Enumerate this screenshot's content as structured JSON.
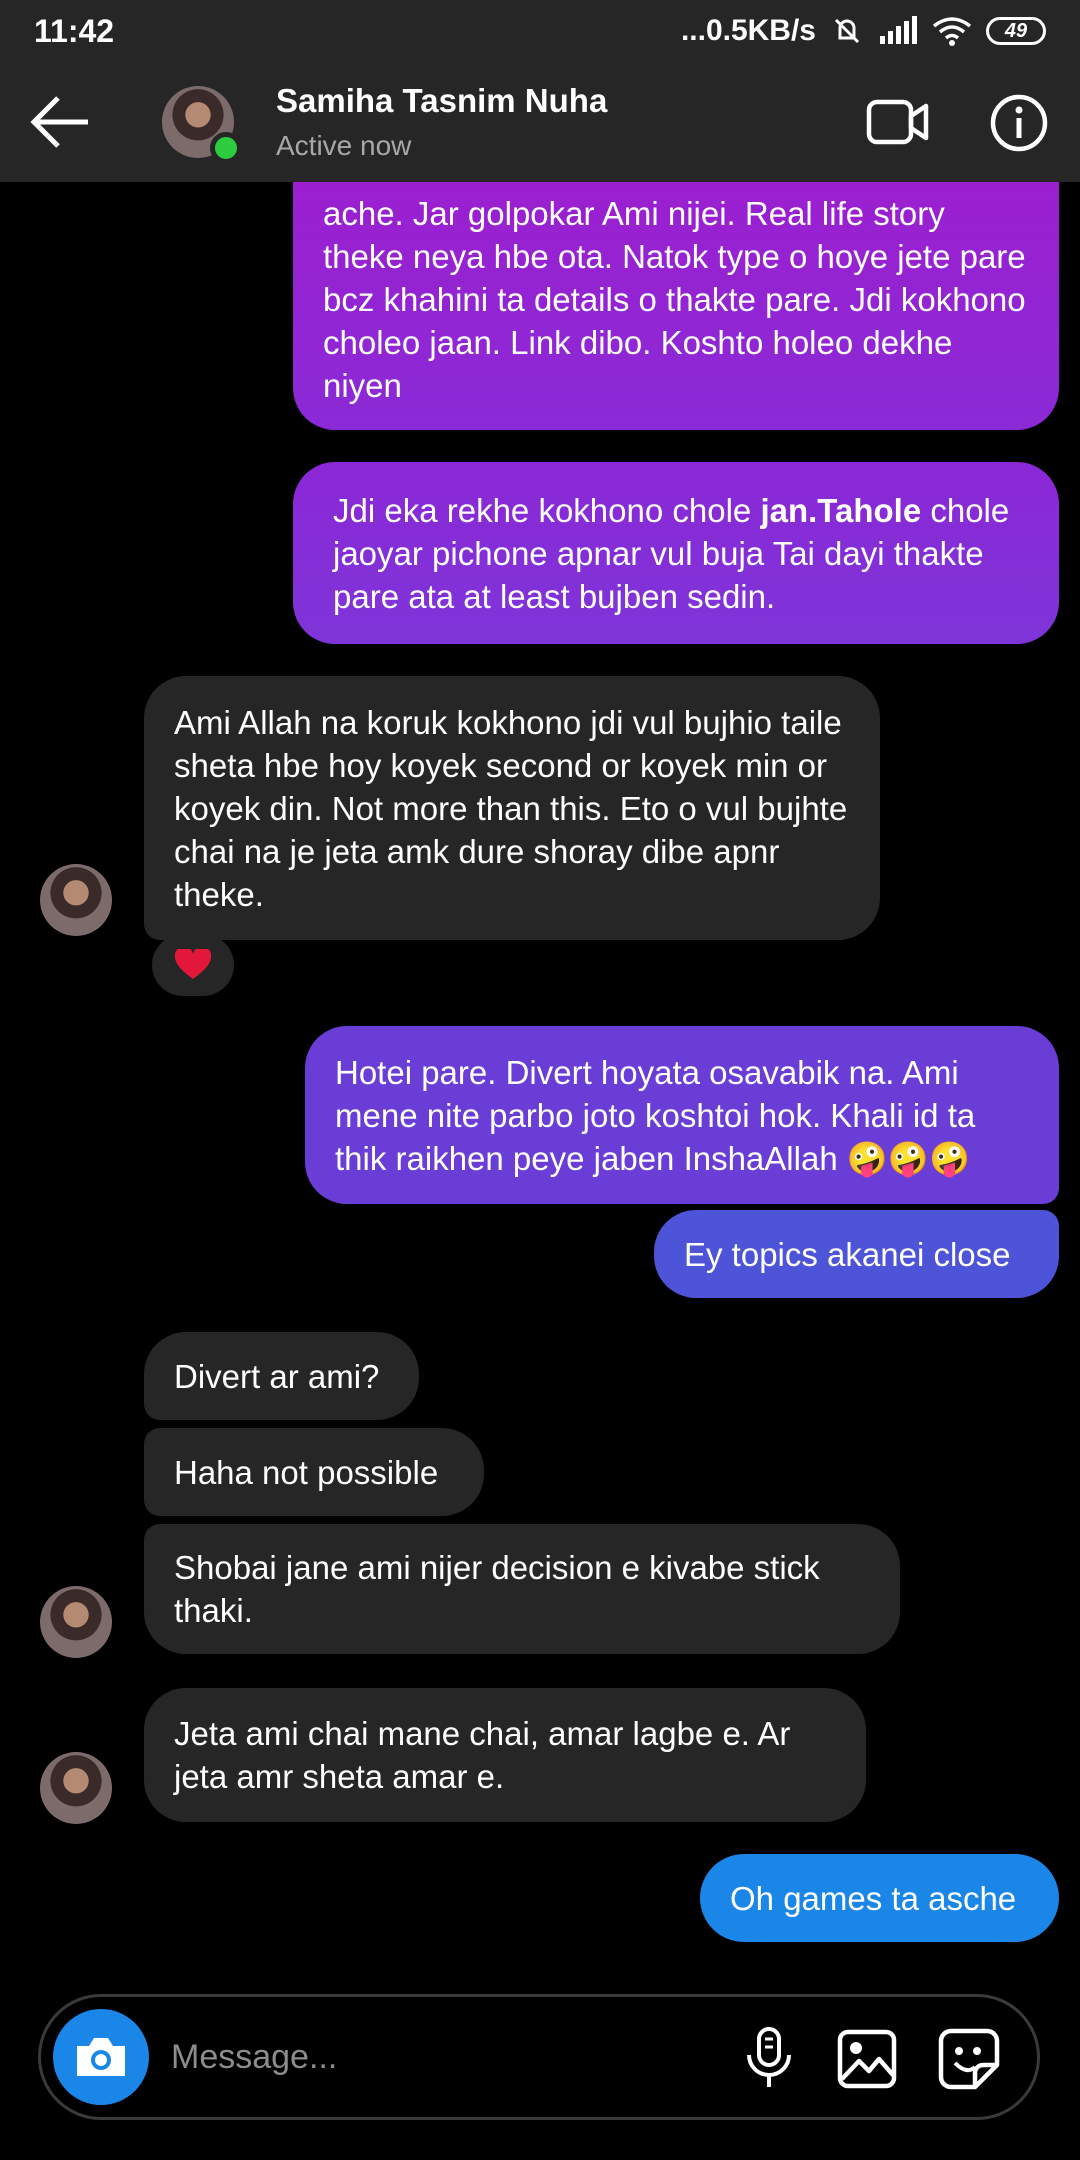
{
  "status_bar": {
    "time": "11:42",
    "network": "...0.5KB/s",
    "battery": "49"
  },
  "header": {
    "name": "Samiha Tasnim Nuha",
    "status": "Active now"
  },
  "messages": [
    {
      "id": "m1",
      "side": "out",
      "text": "ache. Jar golpokar Ami nijei. Real life story theke neya hbe ota. Natok type o hoye jete pare bcz khahini ta details o thakte pare. Jdi kokhono choleo jaan. Link dibo. Koshto holeo dekhe niyen"
    },
    {
      "id": "m2",
      "side": "out",
      "text_before": "Jdi eka rekhe kokhono chole ",
      "text_bold": "jan.Tahole",
      "text_after": " chole jaoyar pichone apnar vul buja Tai dayi thakte pare ata at least bujben sedin."
    },
    {
      "id": "m3",
      "side": "in",
      "text": "Ami Allah na koruk kokhono jdi vul bujhio taile sheta hbe hoy koyek second or koyek min or koyek din. Not more than this. Eto o vul bujhte chai na je jeta amk dure shoray dibe apnr theke.",
      "reaction": "❤️"
    },
    {
      "id": "m4",
      "side": "out",
      "text": "Hotei pare. Divert hoyata osavabik na. Ami mene nite parbo joto koshtoi hok. Khali id ta thik raikhen peye jaben InshaAllah 🤪🤪🤪"
    },
    {
      "id": "m5",
      "side": "out",
      "text": "Ey topics akanei close"
    },
    {
      "id": "m6",
      "side": "in",
      "text": "Divert ar ami?"
    },
    {
      "id": "m7",
      "side": "in",
      "text": "Haha not possible"
    },
    {
      "id": "m8",
      "side": "in",
      "text": "Shobai jane ami nijer decision e kivabe stick thaki."
    },
    {
      "id": "m9",
      "side": "in",
      "text": "Jeta ami chai mane chai, amar lagbe e. Ar jeta amr sheta amar e."
    },
    {
      "id": "m10",
      "side": "out",
      "text": "Oh games ta asche"
    }
  ],
  "composer": {
    "placeholder": "Message..."
  },
  "colors": {
    "bar_bg": "#262626",
    "incoming_bg": "#262626",
    "outgoing_purple": "#9b1fd0",
    "outgoing_violet": "#6a3ed6",
    "outgoing_indigo": "#4d54d8",
    "outgoing_blue": "#1a86e8",
    "online": "#2ecc40"
  },
  "icons": [
    "back-arrow-icon",
    "video-camera-icon",
    "info-icon",
    "camera-icon",
    "microphone-icon",
    "gallery-icon",
    "sticker-icon",
    "heart-icon"
  ]
}
